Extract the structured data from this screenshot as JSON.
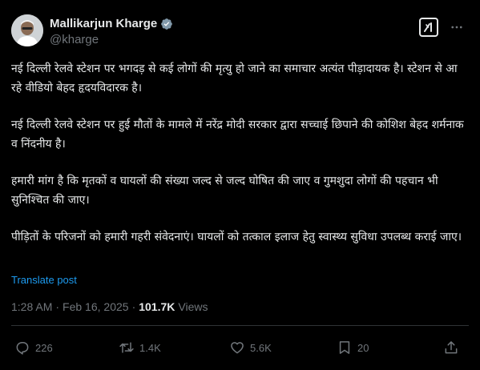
{
  "author": {
    "name": "Mallikarjun Kharge",
    "handle": "@kharge",
    "verified": true
  },
  "tweet": {
    "paragraphs": [
      "नई दिल्ली रेलवे स्टेशन पर भगदड़ से कई लोगों की मृत्यु हो जाने का समाचार अत्यंत पीड़ादायक है। स्टेशन से आ रहे वीडियो बेहद हृदयविदारक है।",
      "नई दिल्ली रेलवे स्टेशन पर हुई मौतों के मामले में नरेंद्र मोदी सरकार द्वारा सच्चाई छिपाने की कोशिश बेहद शर्मनाक व निंदनीय है।",
      "हमारी मांग है कि मृतकों व घायलों की संख्या जल्द से जल्द घोषित की जाए व गुमशुदा लोगों की पहचान भी सुनिश्चित की जाए।",
      "पीड़ितों के परिजनों को हमारी गहरी संवेदनाएं। घायलों को तत्काल इलाज हेतु स्वास्थ्य सुविधा उपलब्ध कराई जाए।"
    ],
    "translate_label": "Translate post"
  },
  "meta": {
    "time": "1:28 AM",
    "separator": "·",
    "date": "Feb 16, 2025",
    "views_count": "101.7K",
    "views_label": "Views"
  },
  "actions": {
    "replies": "226",
    "reposts": "1.4K",
    "likes": "5.6K",
    "bookmarks": "20"
  },
  "colors": {
    "background": "#000000",
    "text": "#e7e9ea",
    "secondary_text": "#71767b",
    "accent": "#1d9bf0",
    "divider": "#2f3336"
  }
}
